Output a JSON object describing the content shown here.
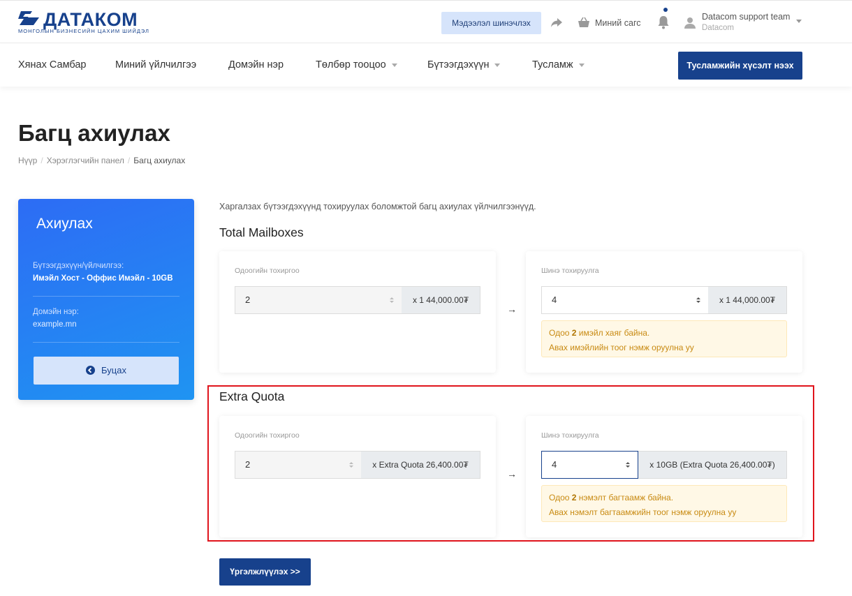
{
  "header": {
    "logo_text": "ДАТАКОМ",
    "logo_sub": "МОНГОЛЫН БИЗНЕСИЙН ЦАХИМ ШИЙДЭЛ",
    "update_button": "Мэдээлэл шинэчлэх",
    "cart_label": "Миний сагс",
    "user_name": "Datacom support team",
    "user_sub": "Datacom"
  },
  "nav": {
    "items": [
      "Хянах Самбар",
      "Миний үйлчилгээ",
      "Домэйн нэр",
      "Төлбөр тооцоо",
      "Бүтээгдэхүүн",
      "Тусламж"
    ],
    "support_button": "Тусламжийн хүсэлт нээх"
  },
  "page": {
    "title": "Багц ахиулах",
    "breadcrumb": [
      "Нүүр",
      "Хэрэглэгчийн панел",
      "Багц ахиулах"
    ]
  },
  "sidebar": {
    "title": "Ахиулах",
    "product_label": "Бүтээгдэхүүн/үйлчилгээ:",
    "product_value": "Имэйл Хост - Оффис Имэйл - 10GB",
    "domain_label": "Домэйн нэр:",
    "domain_value": "example.mn",
    "back_button": "Буцах"
  },
  "main": {
    "intro": "Харгалзах бүтээгдэхүүнд тохируулах боломжтой багц ахиулах үйлчилгээнүүд.",
    "sections": [
      {
        "title": "Total Mailboxes",
        "current_label": "Одоогийн тохиргоо",
        "current_value": "2",
        "current_addon": "x 1 44,000.00₮",
        "new_label": "Шинэ тохируулга",
        "new_value": "4",
        "new_addon": "x 1 44,000.00₮",
        "note_pre": "Одоо ",
        "note_num": "2",
        "note_post": " имэйл хаяг байна.",
        "note_line2": "Авах имэйлийн тоог нэмж оруулна уу"
      },
      {
        "title": "Extra Quota",
        "current_label": "Одоогийн тохиргоо",
        "current_value": "2",
        "current_addon": "x Extra Quota 26,400.00₮",
        "new_label": "Шинэ тохируулга",
        "new_value": "4",
        "new_addon": "x 10GB (Extra Quota 26,400.00₮)",
        "note_pre": "Одоо ",
        "note_num": "2",
        "note_post": " нэмэлт багтаамж байна.",
        "note_line2": "Авах нэмэлт багтаамжийн тоог нэмж оруулна уу"
      }
    ],
    "arrow": "→",
    "continue_button": "Үргэлжлүүлэх >>"
  },
  "colors": {
    "brand": "#17418c",
    "highlight_box": "#e0141c",
    "note_text": "#c88a12"
  }
}
